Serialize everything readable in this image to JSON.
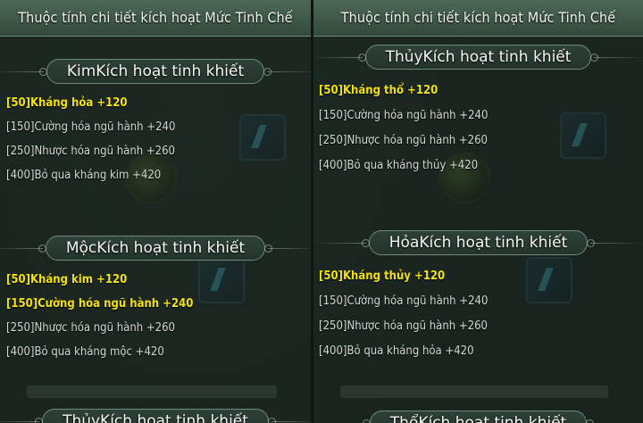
{
  "left_panel": {
    "title": "Thuộc tính chi tiết kích hoạt Mức Tinh Chế",
    "sections": [
      {
        "header": "KimKích hoạt tinh khiết",
        "attributes": [
          {
            "text": "[50]Kháng hỏa +120",
            "active": true
          },
          {
            "text": "[150]Cường hóa ngũ hành +240",
            "active": false
          },
          {
            "text": "[250]Nhược hóa ngũ hành +260",
            "active": false
          },
          {
            "text": "[400]Bỏ qua kháng kim +420",
            "active": false
          }
        ]
      },
      {
        "header": "MộcKích hoạt tinh khiết",
        "attributes": [
          {
            "text": "[50]Kháng kim +120",
            "active": true
          },
          {
            "text": "[150]Cường hóa ngũ hành +240",
            "active": true
          },
          {
            "text": "[250]Nhược hóa ngũ hành +260",
            "active": false
          },
          {
            "text": "[400]Bỏ qua kháng mộc +420",
            "active": false
          }
        ]
      },
      {
        "header": "ThủyKích hoạt tinh khiết",
        "attributes": []
      }
    ]
  },
  "right_panel": {
    "title": "Thuộc tính chi tiết kích hoạt Mức Tinh Chế",
    "sections": [
      {
        "header": "ThủyKích hoạt tinh khiết",
        "attributes": [
          {
            "text": "[50]Kháng thổ +120",
            "active": true
          },
          {
            "text": "[150]Cường hóa ngũ hành +240",
            "active": false
          },
          {
            "text": "[250]Nhược hóa ngũ hành +260",
            "active": false
          },
          {
            "text": "[400]Bỏ qua kháng thủy +420",
            "active": false
          }
        ]
      },
      {
        "header": "HỏaKích hoạt tinh khiết",
        "attributes": [
          {
            "text": "[50]Kháng thủy +120",
            "active": true
          },
          {
            "text": "[150]Cường hóa ngũ hành +240",
            "active": false
          },
          {
            "text": "[250]Nhược hóa ngũ hành +260",
            "active": false
          },
          {
            "text": "[400]Bỏ qua kháng hỏa +420",
            "active": false
          }
        ]
      },
      {
        "header": "ThổKích hoạt tinh khiết",
        "attributes": []
      }
    ]
  },
  "colors": {
    "active_text": "#f2e20a",
    "inactive_text": "#d6d8d2",
    "title_bar": "#3e5748"
  }
}
